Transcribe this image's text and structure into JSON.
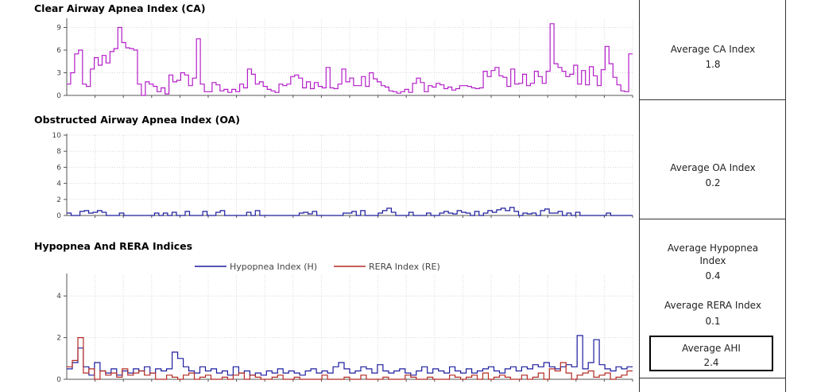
{
  "colors": {
    "ca": "#b31ec8",
    "oa": "#1c1c9e",
    "hyp": "#1c1c9e",
    "rera": "#b42a22",
    "grid": "#d8d8d8",
    "axis": "#555555"
  },
  "ca_panel": {
    "title": "Clear Airway Apnea Index (CA)"
  },
  "oa_panel": {
    "title": "Obstructed Airway Apnea Index (OA)"
  },
  "hyp_panel": {
    "title": "Hypopnea And RERA Indices"
  },
  "summary": {
    "ca": {
      "label": "Average CA Index",
      "value": "1.8"
    },
    "oa": {
      "label": "Average OA Index",
      "value": "0.2"
    },
    "hypopnea": {
      "label": "Average Hypopnea Index",
      "value": "0.4"
    },
    "rera": {
      "label": "Average RERA Index",
      "value": "0.1"
    },
    "ahi": {
      "label": "Average AHI",
      "value": "2.4"
    }
  },
  "chart_data": [
    {
      "type": "line",
      "title": "Clear Airway Apnea Index (CA)",
      "ylim": [
        0,
        10
      ],
      "yticks": [
        0,
        3,
        6,
        9
      ],
      "grid": true,
      "series": [
        {
          "values": [
            1.5,
            3,
            5.5,
            6,
            1.5,
            1.2,
            3.5,
            5,
            4,
            5.3,
            4.3,
            5.8,
            6.2,
            9,
            7,
            6.3,
            6.2,
            6,
            1.5,
            0,
            1.8,
            1.5,
            1.2,
            0.5,
            1,
            0.2,
            2.7,
            1.8,
            2,
            3,
            2.7,
            1.3,
            2.3,
            7.5,
            1.5,
            0.5,
            0.5,
            1.7,
            1.4,
            0.6,
            0.8,
            0.4,
            0.8,
            0.5,
            1.5,
            1,
            3.5,
            2.8,
            1.5,
            1.8,
            1.2,
            0.8,
            0.6,
            0.4,
            1.5,
            1.3,
            1.5,
            2.5,
            2.7,
            2.3,
            1,
            1.8,
            0.9,
            1.7,
            1.2,
            1,
            3.7,
            1,
            0.9,
            1.5,
            3.5,
            1.8,
            2.3,
            1.3,
            1.3,
            2.5,
            1.2,
            3,
            2.2,
            1.8,
            1.3,
            1.1,
            0.6,
            0.5,
            0.3,
            0.5,
            0.8,
            0.4,
            1.6,
            2.3,
            1.7,
            0.5,
            1.3,
            1.1,
            1.6,
            1.4,
            0.9,
            1.1,
            0.7,
            0.9,
            1.3,
            1.3,
            1.2,
            1,
            0.9,
            1,
            3.2,
            2.5,
            3.3,
            3.7,
            2.6,
            2.4,
            1.2,
            3.5,
            1.5,
            1.6,
            2.8,
            1.3,
            1.6,
            3.2,
            2.5,
            1.6,
            3.2,
            9.5,
            4.2,
            3.7,
            3.2,
            2.5,
            2.8,
            4,
            1.5,
            3.3,
            1.4,
            3.8,
            2.6,
            1.3,
            3.4,
            6.5,
            4.2,
            2.4,
            1.4,
            0.6,
            0.5,
            5.5
          ]
        }
      ]
    },
    {
      "type": "line",
      "title": "Obstructed Airway Apnea Index (OA)",
      "ylim": [
        0,
        10
      ],
      "yticks": [
        0,
        2,
        4,
        6,
        8,
        10
      ],
      "grid": true,
      "series": [
        {
          "values": [
            0.3,
            0,
            0,
            0.5,
            0.6,
            0.3,
            0.4,
            0.6,
            0.4,
            0,
            0,
            0,
            0.3,
            0,
            0,
            0,
            0,
            0,
            0,
            0,
            0.3,
            0,
            0.3,
            0,
            0.4,
            0,
            0,
            0.5,
            0,
            0,
            0,
            0.5,
            0,
            0,
            0.4,
            0.6,
            0,
            0,
            0,
            0,
            0,
            0.4,
            0,
            0.6,
            0,
            0,
            0,
            0,
            0,
            0,
            0,
            0,
            0,
            0.3,
            0.4,
            0.2,
            0.5,
            0,
            0,
            0,
            0,
            0,
            0,
            0.3,
            0.3,
            0.5,
            0,
            0.6,
            0,
            0,
            0,
            0.3,
            0.6,
            0.9,
            0.4,
            0,
            0,
            0,
            0.4,
            0,
            0,
            0,
            0.3,
            0,
            0,
            0.3,
            0.5,
            0.3,
            0.2,
            0.6,
            0.4,
            0.3,
            0,
            0.5,
            0,
            0.3,
            0.6,
            0.4,
            0.7,
            0.9,
            0.6,
            1,
            0.5,
            0,
            0.3,
            0.2,
            0.3,
            0,
            0.6,
            0.8,
            0.3,
            0.3,
            0.5,
            0,
            0.3,
            0,
            0.4,
            0,
            0,
            0,
            0,
            0,
            0,
            0.3,
            0,
            0,
            0,
            0,
            0
          ]
        }
      ]
    },
    {
      "type": "line",
      "title": "Hypopnea And RERA Indices",
      "ylim": [
        0,
        5
      ],
      "yticks": [
        0,
        2,
        4
      ],
      "grid": true,
      "legend": "top",
      "series": [
        {
          "name": "Hypopnea Index (H)",
          "values": [
            0.5,
            0.8,
            1.5,
            0.6,
            0.2,
            0.8,
            0.4,
            0.3,
            0.5,
            0.2,
            0.4,
            0.3,
            0.5,
            0.4,
            0.6,
            0.3,
            0.5,
            0.4,
            0.5,
            1.3,
            1,
            0.6,
            0.4,
            0.3,
            0.6,
            0.4,
            0.5,
            0.3,
            0.4,
            0.2,
            0.6,
            0.3,
            0.4,
            0.2,
            0.3,
            0.2,
            0.4,
            0.3,
            0.5,
            0.3,
            0.4,
            0.3,
            0.2,
            0.4,
            0.5,
            0.3,
            0.4,
            0.3,
            0.6,
            0.8,
            0.5,
            0.3,
            0.4,
            0.6,
            0.5,
            0.3,
            0.7,
            0.4,
            0.3,
            0.4,
            0.5,
            0.3,
            0.2,
            0.4,
            0.6,
            0.3,
            0.5,
            0.4,
            0.3,
            0.6,
            0.4,
            0.3,
            0.5,
            0.3,
            0.4,
            0.5,
            0.6,
            0.4,
            0.3,
            0.5,
            0.6,
            0.4,
            0.6,
            0.5,
            0.7,
            0.6,
            0.8,
            0.6,
            0.5,
            0.6,
            0.7,
            0.6,
            2.1,
            0.5,
            0.8,
            1.9,
            0.7,
            0.5,
            0.4,
            0.6,
            0.5,
            0.6
          ]
        },
        {
          "name": "RERA Index (RE)",
          "values": [
            0.6,
            0.9,
            2,
            0.3,
            0.5,
            0,
            0.4,
            0.2,
            0.3,
            0.1,
            0.5,
            0.2,
            0.3,
            0.4,
            0.2,
            0.3,
            0,
            0,
            0.2,
            0.1,
            0,
            0.2,
            0.3,
            0,
            0.1,
            0.2,
            0,
            0,
            0.1,
            0,
            0.2,
            0.3,
            0,
            0.2,
            0.1,
            0,
            0,
            0.1,
            0.2,
            0,
            0,
            0.1,
            0,
            0,
            0,
            0,
            0.2,
            0,
            0,
            0,
            0.1,
            0,
            0,
            0.2,
            0,
            0,
            0,
            0.1,
            0,
            0,
            0,
            0.2,
            0.1,
            0,
            0,
            0.1,
            0,
            0,
            0,
            0.2,
            0.1,
            0,
            0.1,
            0.2,
            0,
            0.3,
            0,
            0.1,
            0.2,
            0.1,
            0,
            0,
            0.2,
            0,
            0.1,
            0.3,
            0,
            0.5,
            0.4,
            0.8,
            0.3,
            0,
            0.2,
            0.3,
            0.4,
            0.1,
            0.2,
            0.3,
            0,
            0.1,
            0.2,
            0.4
          ]
        }
      ]
    }
  ]
}
